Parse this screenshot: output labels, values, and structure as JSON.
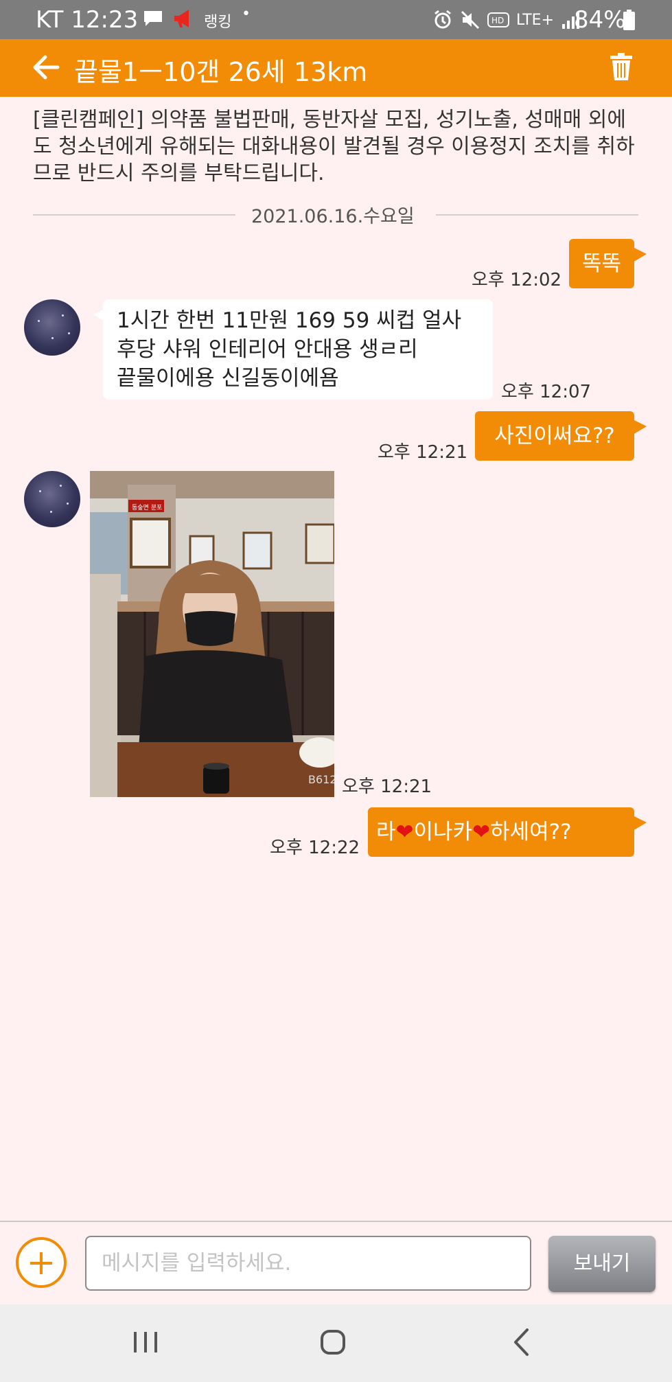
{
  "status_bar": {
    "carrier_time": "KT 12:23",
    "ranking_label": "랭킹",
    "dot": "•",
    "lte_label": "LTE+",
    "battery_percent": "84%"
  },
  "header": {
    "title": "끝물1ㅡ10갠 26세 13km"
  },
  "notice": "[클린캠페인] 의약품 불법판매, 동반자살 모집, 성기노출, 성매매 외에도 청소년에게 유해되는 대화내용이 발견될 경우 이용정지 조치를 취하므로 반드시 주의를 부탁드립니다.",
  "date_separator": "2021.06.16.수요일",
  "messages": [
    {
      "direction": "out",
      "text": "똑똑",
      "time": "오후 12:02"
    },
    {
      "direction": "in",
      "lines": [
        "1시간 한번 11만원 169 59 씨컵 얼사",
        "후당 샤워 인테리어 안대용 생ㄹ리",
        "끝물이에용 신길동이에욤"
      ],
      "time": "오후 12:07"
    },
    {
      "direction": "out",
      "text": "사진이써요??",
      "time": "오후 12:21"
    },
    {
      "direction": "in",
      "type": "image",
      "time": "오후 12:21",
      "sign_text": "B612",
      "photo_sign": "동숲면 분포"
    },
    {
      "direction": "out",
      "parts": [
        "라",
        "이나카",
        "하세여??"
      ],
      "time": "오후 12:22"
    }
  ],
  "composer": {
    "placeholder": "메시지를 입력하세요.",
    "send_label": "보내기"
  },
  "colors": {
    "accent": "#f28c07",
    "background": "#fff1f1",
    "statusbar": "#7d7d7d"
  }
}
